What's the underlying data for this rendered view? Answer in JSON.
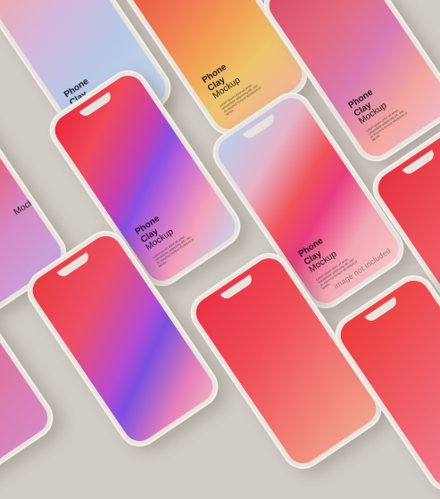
{
  "mockup": {
    "line1": "Phone",
    "line2": "Clay",
    "line3": "Mockup",
    "body_text": "Lorem ipsum dolor sit amet, consectetur adipiscing elit, sed do eiusmod tempor incididunt ut labore."
  },
  "note": "image not included",
  "colors": {
    "background": "#d2ccc6",
    "phone_body": "#e8e3dd",
    "text": "#1d1d1d"
  }
}
